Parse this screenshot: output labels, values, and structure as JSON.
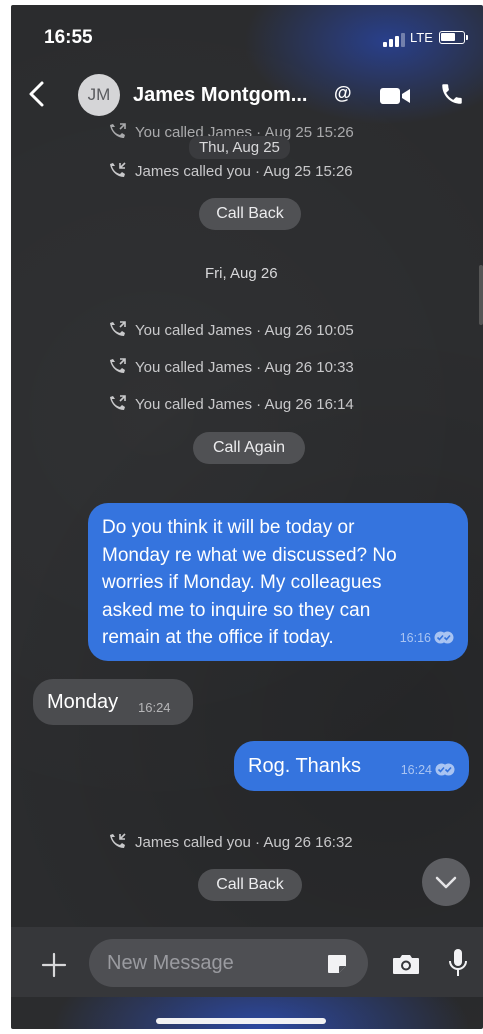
{
  "status_bar": {
    "time": "16:55",
    "network": "LTE",
    "battery_level": 0.65
  },
  "header": {
    "avatar_initials": "JM",
    "contact_name": "James Montgom..."
  },
  "thread": {
    "log_top_1": "You called James · Aug 25 15:26",
    "date_thu": "Thu, Aug 25",
    "log_top_2": "James called you · Aug 25 15:26",
    "call_back_1": "Call Back",
    "date_fri": "Fri, Aug 26",
    "log_fri_1": "You called James · Aug 26 10:05",
    "log_fri_2": "You called James · Aug 26 10:33",
    "log_fri_3": "You called James · Aug 26 16:14",
    "call_again": "Call Again",
    "msg_out_1_lines": [
      "Do you think it will be today or",
      "Monday re what we discussed? No",
      "worries if Monday. My colleagues",
      "asked me to inquire so they can",
      "remain at the office if today."
    ],
    "msg_out_1_time": "16:16",
    "msg_in_1": "Monday",
    "msg_in_1_time": "16:24",
    "msg_out_2": "Rog. Thanks",
    "msg_out_2_time": "16:24",
    "log_last": "James called you · Aug 26 16:32",
    "call_back_2": "Call Back"
  },
  "composer": {
    "placeholder": "New Message"
  },
  "colors": {
    "outgoing_bubble": "#3574de",
    "incoming_bubble": "#4b4c4f",
    "background": "#2b2c2e"
  }
}
